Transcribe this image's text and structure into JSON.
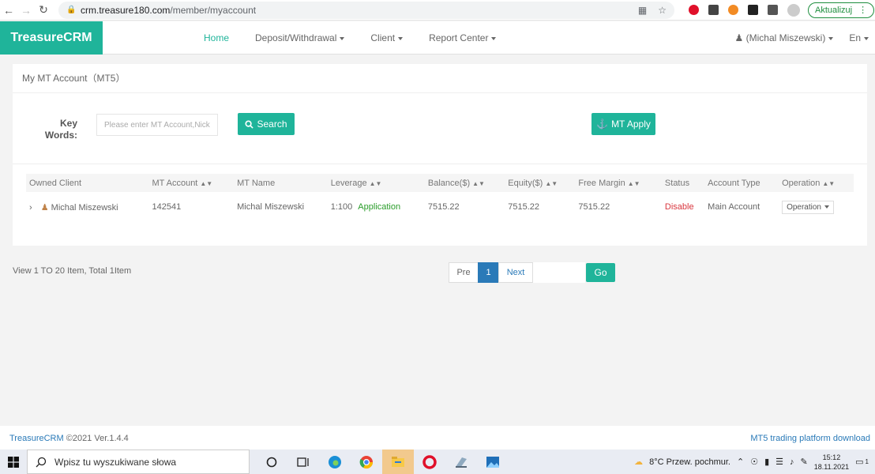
{
  "browser": {
    "url_domain": "crm.treasure180.com",
    "url_path": "/member/myaccount",
    "update_label": "Aktualizuj"
  },
  "navbar": {
    "brand": "TreasureCRM",
    "menu": [
      {
        "label": "Home"
      },
      {
        "label": "Deposit/Withdrawal"
      },
      {
        "label": "Client"
      },
      {
        "label": "Report Center"
      }
    ],
    "user": "(Michal Miszewski)",
    "language": "En"
  },
  "panel": {
    "title": "My MT Account（MT5）",
    "keywords_label": "Key Words:",
    "search_placeholder": "Please enter MT Account,Nick",
    "search_button": "Search",
    "apply_button": "MT Apply"
  },
  "table": {
    "columns": [
      "Owned Client",
      "MT Account",
      "MT Name",
      "Leverage",
      "Balance($)",
      "Equity($)",
      "Free Margin",
      "Status",
      "Account Type",
      "Operation"
    ],
    "rows": [
      {
        "owned_client": "Michal Miszewski",
        "mt_account": "142541",
        "mt_name": "Michal Miszewski",
        "leverage": "1:100",
        "leverage_link": "Application",
        "balance": "7515.22",
        "equity": "7515.22",
        "free_margin": "7515.22",
        "status": "Disable",
        "account_type": "Main Account",
        "operation": "Operation"
      }
    ]
  },
  "pagination": {
    "info": "View 1 TO 20 Item, Total 1Item",
    "prev": "Pre",
    "current": "1",
    "next": "Next",
    "go": "Go"
  },
  "footer": {
    "brand": "TreasureCRM",
    "copyright": " ©2021 Ver.1.4.4",
    "download": "MT5 trading platform download"
  },
  "taskbar": {
    "search_placeholder": "Wpisz tu wyszukiwane słowa",
    "weather": "8°C  Przew. pochmur.",
    "time": "15:12",
    "date": "18.11.2021",
    "notifications": "1"
  },
  "colors": {
    "accent": "#1fb49a",
    "link": "#2a7ab8",
    "disable": "#d9363e",
    "application": "#2a9d2a"
  }
}
